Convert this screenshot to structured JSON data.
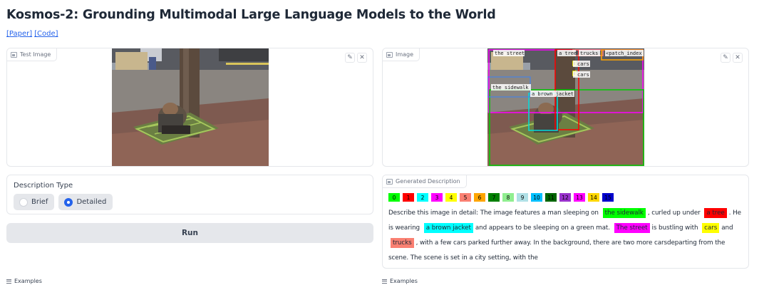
{
  "header": {
    "title": "Kosmos-2: Grounding Multimodal Large Language Models to the World",
    "links": [
      "[Paper]",
      "[Code]"
    ]
  },
  "test_image_panel": {
    "label": "Test Image"
  },
  "image_panel": {
    "label": "Image",
    "box_labels": [
      "the street",
      "a tree",
      "trucks",
      "<patch_index",
      "cars",
      "cars",
      "the sidewalk",
      "a brown jacket"
    ]
  },
  "description_type": {
    "title": "Description Type",
    "options": [
      "Brief",
      "Detailed"
    ],
    "selected": "Detailed"
  },
  "run_button": {
    "label": "Run"
  },
  "generated_description": {
    "label": "Generated Description",
    "chips": [
      {
        "label": "0",
        "color": "#00ff00"
      },
      {
        "label": "1",
        "color": "#ff0000"
      },
      {
        "label": "2",
        "color": "#00ffff"
      },
      {
        "label": "3",
        "color": "#ff00ff"
      },
      {
        "label": "4",
        "color": "#ffff00"
      },
      {
        "label": "5",
        "color": "#fa8072"
      },
      {
        "label": "6",
        "color": "#ffa500"
      },
      {
        "label": "7",
        "color": "#008000"
      },
      {
        "label": "8",
        "color": "#90ee90"
      },
      {
        "label": "9",
        "color": "#b0e0e6"
      },
      {
        "label": "10",
        "color": "#00bfff"
      },
      {
        "label": "11",
        "color": "#006400"
      },
      {
        "label": "12",
        "color": "#9932cc"
      },
      {
        "label": "13",
        "color": "#ff00ff"
      },
      {
        "label": "14",
        "color": "#ffd700"
      },
      {
        "label": "15",
        "color": "#0000cd"
      }
    ],
    "segments": [
      {
        "text": "Describe this image in detail: The image features a man sleeping on"
      },
      {
        "text": "the sidewalk",
        "color": "#00ff00"
      },
      {
        "text": ", curled up under"
      },
      {
        "text": "a tree",
        "color": "#ff0000"
      },
      {
        "text": ". He is wearing"
      },
      {
        "text": "a brown jacket",
        "color": "#00ffff"
      },
      {
        "text": "and appears to be sleeping on a green mat."
      },
      {
        "text": "The street",
        "color": "#ff00ff"
      },
      {
        "text": "is bustling with"
      },
      {
        "text": "cars",
        "color": "#ffff00"
      },
      {
        "text": "and"
      },
      {
        "text": "trucks",
        "color": "#fa8072"
      },
      {
        "text": ", with a few cars parked further away. In the background, there are two more carsdeparting from the scene. The scene is set in a city setting, with the"
      }
    ]
  },
  "examples": {
    "left": "Examples",
    "right": "Examples"
  },
  "colors": {
    "accent": "#2563eb",
    "button_bg": "#e5e7eb",
    "border": "#e5e7eb"
  }
}
